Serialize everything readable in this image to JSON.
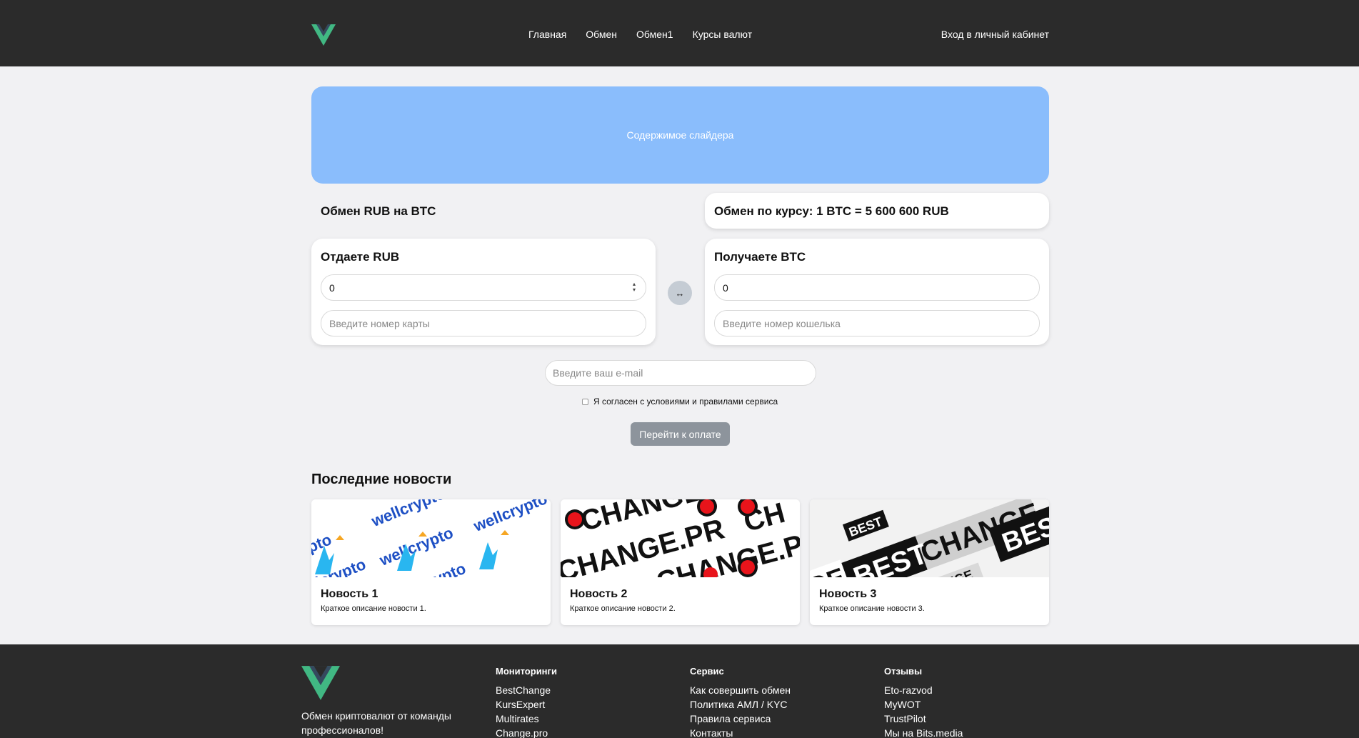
{
  "header": {
    "nav": [
      "Главная",
      "Обмен",
      "Обмен1",
      "Курсы валют"
    ],
    "login": "Вход в личный кабинет"
  },
  "slider": {
    "text": "Содержимое слайдера"
  },
  "exchange": {
    "title": "Обмен RUB на BTC",
    "rate": "Обмен по курсу: 1 BTC = 5 600 600 RUB",
    "give": {
      "title": "Отдаете RUB",
      "amount": "0",
      "card_placeholder": "Введите номер карты"
    },
    "get": {
      "title": "Получаете BTC",
      "amount": "0",
      "wallet_placeholder": "Введите номер кошелька"
    },
    "email_placeholder": "Введите ваш e-mail",
    "agree_label": "Я согласен с условиями и правилами сервиса",
    "pay_button": "Перейти к оплате"
  },
  "news": {
    "title": "Последние новости",
    "items": [
      {
        "title": "Новость 1",
        "desc": "Краткое описание новости 1.",
        "image_text": "wellcrypto"
      },
      {
        "title": "Новость 2",
        "desc": "Краткое описание новости 2.",
        "image_text": "CHANGE.PRO"
      },
      {
        "title": "Новость 3",
        "desc": "Краткое описание новости 3.",
        "image_text": "BEST CHANGE"
      }
    ]
  },
  "footer": {
    "tagline": "Обмен криптовалют от команды профессионалов!",
    "columns": [
      {
        "title": "Мониторинги",
        "links": [
          "BestChange",
          "KursExpert",
          "Multirates",
          "Change.pro"
        ]
      },
      {
        "title": "Сервис",
        "links": [
          "Как совершить обмен",
          "Политика АМЛ / KYC",
          "Правила сервиса",
          "Контакты"
        ]
      },
      {
        "title": "Отзывы",
        "links": [
          "Eto-razvod",
          "MyWOT",
          "TrustPilot",
          "Мы на Bits.media"
        ]
      }
    ]
  },
  "colors": {
    "header_bg": "#2b2b2b",
    "slider_bg": "#8abdfc",
    "logo_green": "#41b883",
    "logo_dark": "#35495e",
    "button_bg": "#8d949c"
  }
}
